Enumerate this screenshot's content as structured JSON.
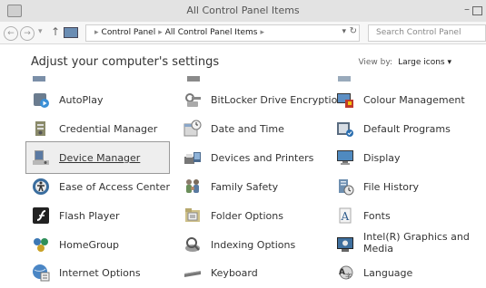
{
  "window": {
    "title": "All Control Panel Items"
  },
  "address_bar": {
    "crumbs": [
      "Control Panel",
      "All Control Panel Items"
    ],
    "search_placeholder": "Search Control Panel"
  },
  "header": {
    "title": "Adjust your computer's settings",
    "view_by_label": "View by:",
    "view_by_value": "Large icons ▾"
  },
  "items": [
    {
      "label": "AutoPlay",
      "icon": "autoplay-icon"
    },
    {
      "label": "BitLocker Drive Encryption",
      "icon": "bitlocker-icon"
    },
    {
      "label": "Colour Management",
      "icon": "colour-management-icon"
    },
    {
      "label": "Credential Manager",
      "icon": "credential-manager-icon"
    },
    {
      "label": "Date and Time",
      "icon": "date-time-icon"
    },
    {
      "label": "Default Programs",
      "icon": "default-programs-icon"
    },
    {
      "label": "Device Manager",
      "icon": "device-manager-icon"
    },
    {
      "label": "Devices and Printers",
      "icon": "devices-printers-icon"
    },
    {
      "label": "Display",
      "icon": "display-icon"
    },
    {
      "label": "Ease of Access Center",
      "icon": "ease-of-access-icon"
    },
    {
      "label": "Family Safety",
      "icon": "family-safety-icon"
    },
    {
      "label": "File History",
      "icon": "file-history-icon"
    },
    {
      "label": "Flash Player",
      "icon": "flash-player-icon"
    },
    {
      "label": "Folder Options",
      "icon": "folder-options-icon"
    },
    {
      "label": "Fonts",
      "icon": "fonts-icon"
    },
    {
      "label": "HomeGroup",
      "icon": "homegroup-icon"
    },
    {
      "label": "Indexing Options",
      "icon": "indexing-options-icon"
    },
    {
      "label": "Intel(R) Graphics and Media",
      "icon": "intel-graphics-icon"
    },
    {
      "label": "Internet Options",
      "icon": "internet-options-icon"
    },
    {
      "label": "Keyboard",
      "icon": "keyboard-icon"
    },
    {
      "label": "Language",
      "icon": "language-icon"
    }
  ],
  "selected_item": "Device Manager"
}
